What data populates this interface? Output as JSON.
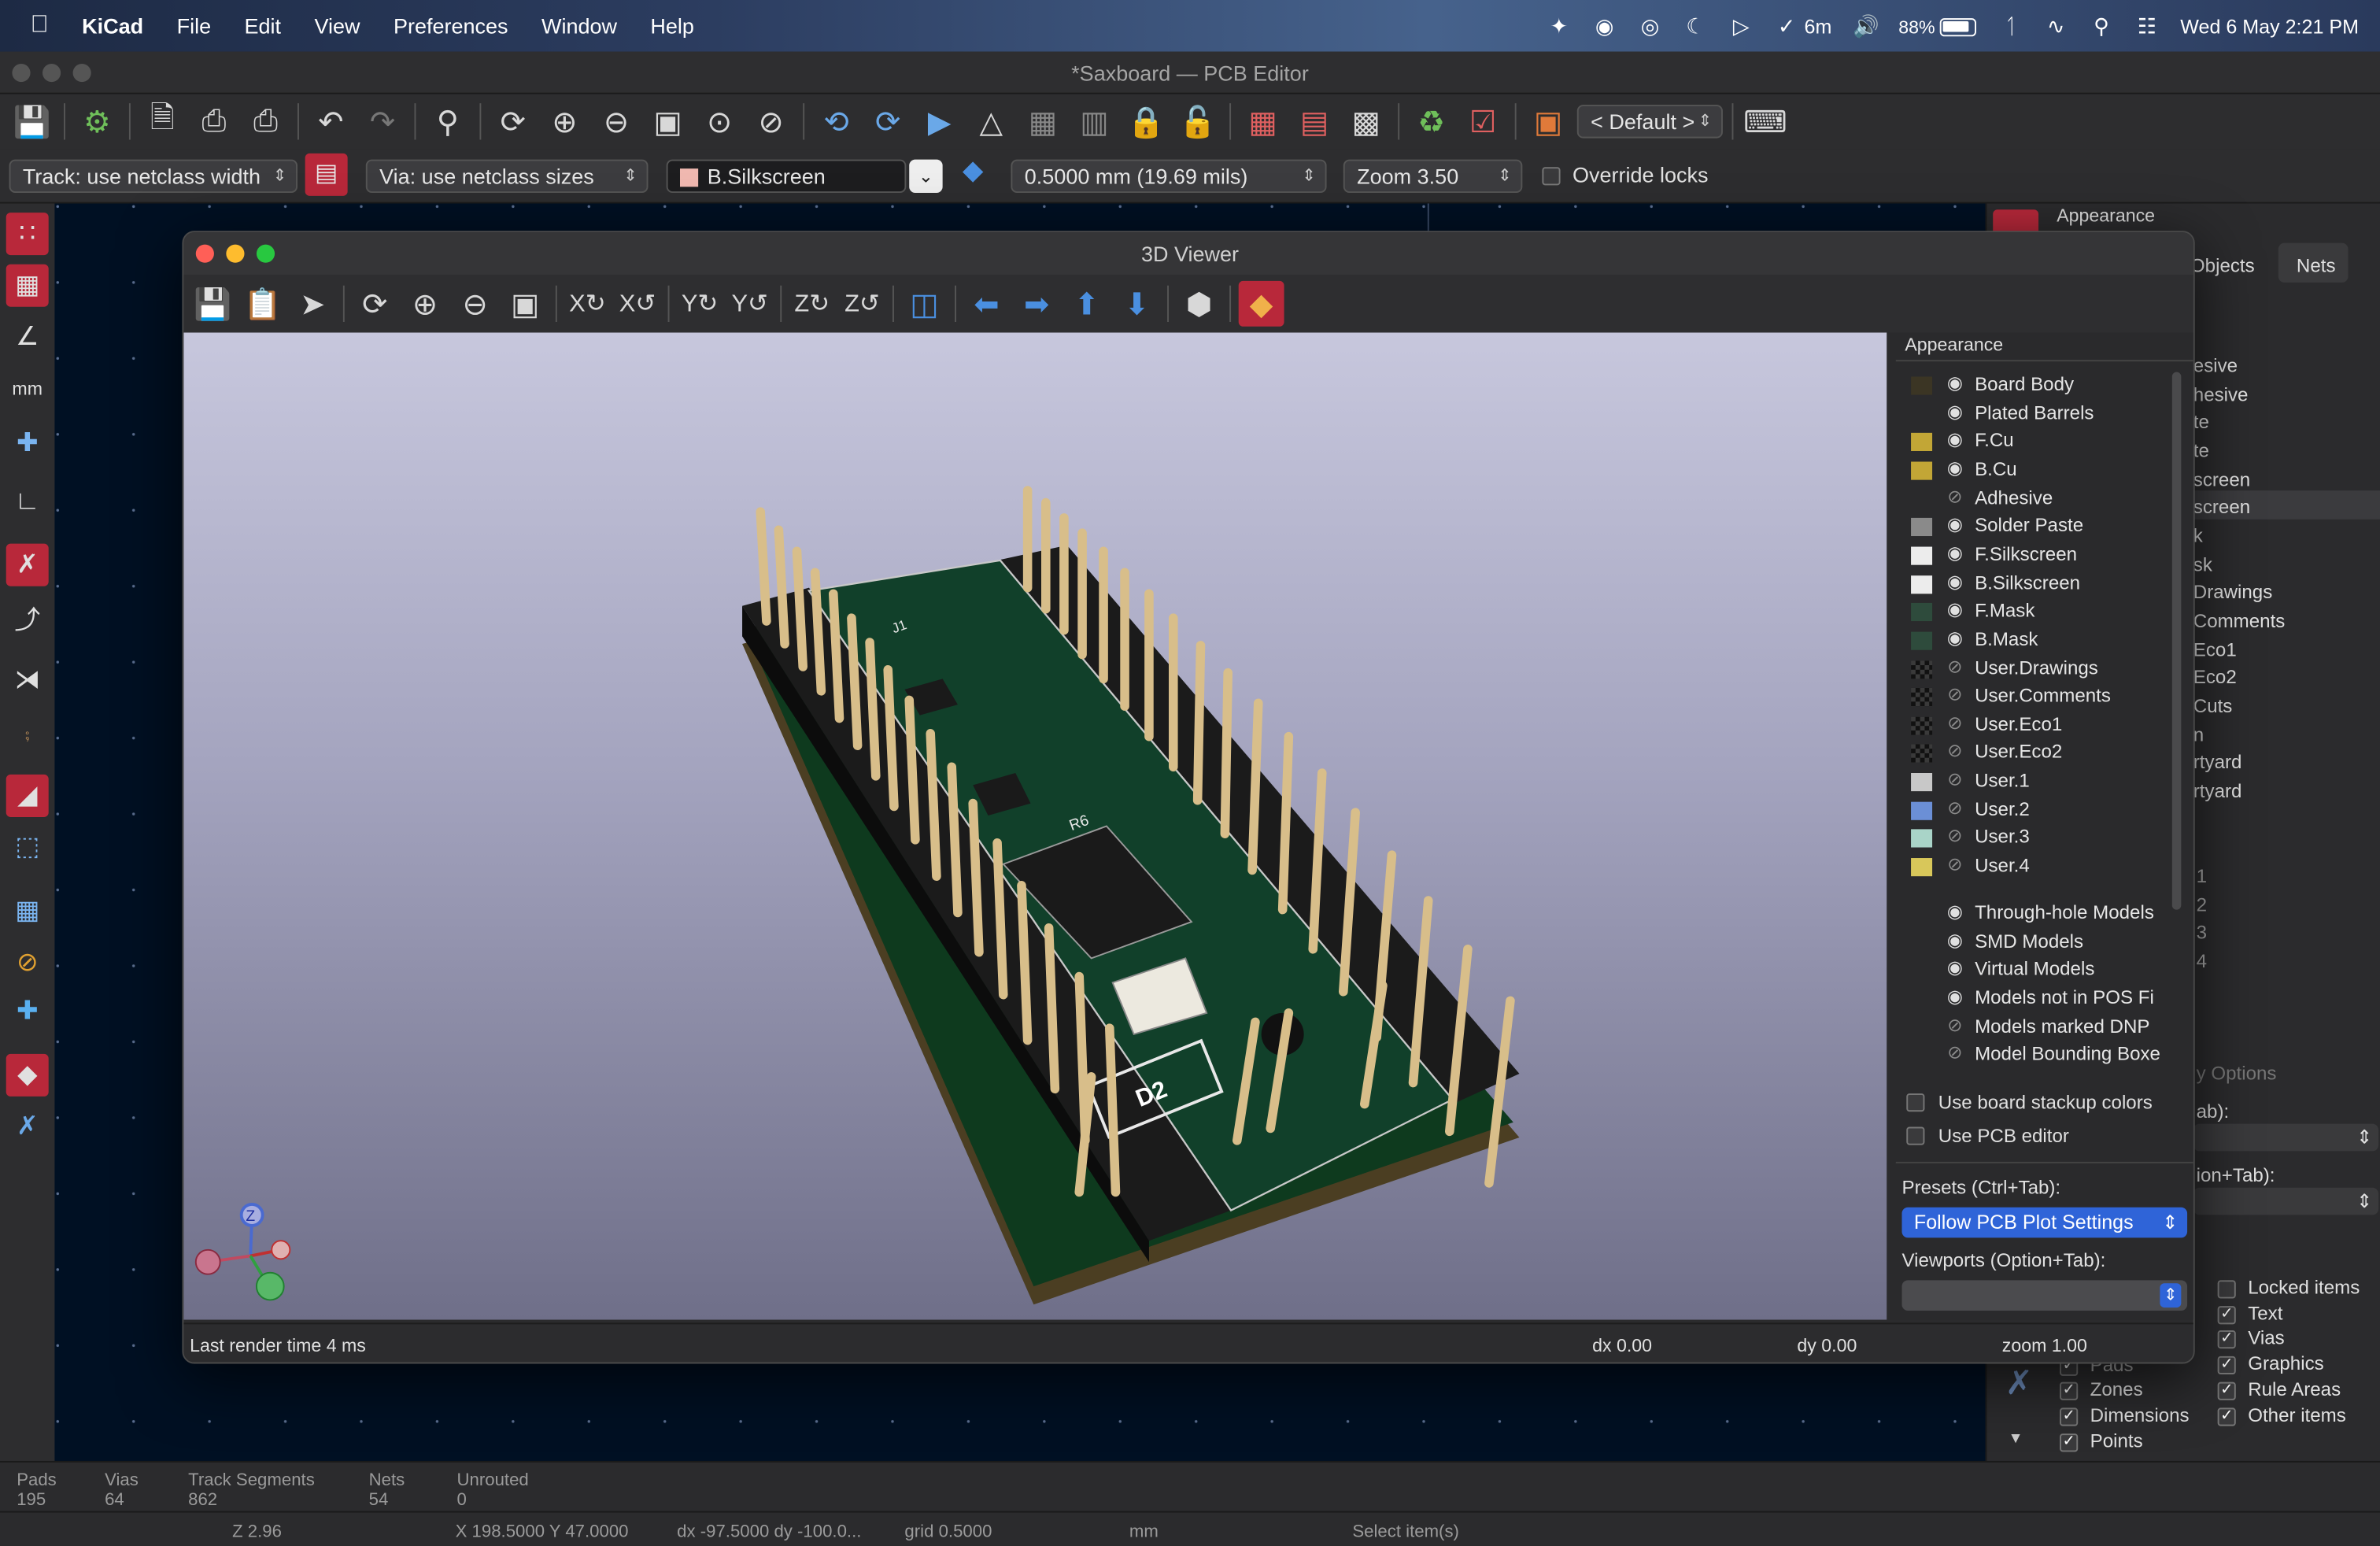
{
  "menubar": {
    "app": "KiCad",
    "menus": [
      "File",
      "Edit",
      "View",
      "Preferences",
      "Window",
      "Help"
    ],
    "timer": "6m",
    "battery": "88%",
    "datetime": "Wed 6 May  2:21 PM"
  },
  "main": {
    "title": "*Saxboard — PCB Editor",
    "preset_select": "< Default >",
    "track_select": "Track: use netclass width",
    "via_select": "Via: use netclass sizes",
    "layer_select": "B.Silkscreen",
    "grid_select": "0.5000 mm (19.69 mils)",
    "zoom_select": "Zoom 3.50",
    "override_locks": "Override locks"
  },
  "rpanel": {
    "title": "Appearance",
    "tab_objects": "Objects",
    "tab_nets": "Nets",
    "layers_partial": [
      "esive",
      "hesive",
      "te",
      "te",
      "screen",
      "screen",
      "k",
      "sk",
      "Drawings",
      "Comments",
      "Eco1",
      "Eco2",
      "Cuts",
      "n",
      "rtyard",
      "rtyard"
    ],
    "nums_partial": [
      "1",
      "2",
      "3",
      "4"
    ],
    "options_partial": "y Options",
    "preset_partial": "ab):",
    "viewport_partial": "ion+Tab):",
    "objects_left": [
      {
        "label": "Pads",
        "checked": true
      },
      {
        "label": "Zones",
        "checked": true
      },
      {
        "label": "Dimensions",
        "checked": true
      },
      {
        "label": "Points",
        "checked": true
      }
    ],
    "objects_right": [
      {
        "label": "Locked items",
        "checked": false
      },
      {
        "label": "Text",
        "checked": true
      },
      {
        "label": "Vias",
        "checked": true
      },
      {
        "label": "Graphics",
        "checked": true
      },
      {
        "label": "Rule Areas",
        "checked": true
      },
      {
        "label": "Other items",
        "checked": true
      }
    ]
  },
  "bottom": {
    "stats": [
      {
        "label": "Pads",
        "value": "195"
      },
      {
        "label": "Vias",
        "value": "64"
      },
      {
        "label": "Track Segments",
        "value": "862"
      },
      {
        "label": "Nets",
        "value": "54"
      },
      {
        "label": "Unrouted",
        "value": "0"
      }
    ],
    "z": "Z 2.96",
    "xy": "X 198.5000  Y 47.0000",
    "dxdy": "dx -97.5000  dy -100.0...",
    "grid": "grid 0.5000",
    "units": "mm",
    "message": "Select item(s)"
  },
  "viewer": {
    "title": "3D Viewer",
    "appearance_title": "Appearance",
    "layers": [
      {
        "name": "Board Body",
        "color": "#3b3524",
        "visible": true
      },
      {
        "name": "Plated Barrels",
        "color": "",
        "visible": true
      },
      {
        "name": "F.Cu",
        "color": "#c2a636",
        "visible": true
      },
      {
        "name": "B.Cu",
        "color": "#c2a636",
        "visible": true
      },
      {
        "name": "Adhesive",
        "color": "",
        "visible": false
      },
      {
        "name": "Solder Paste",
        "color": "#8a8a8a",
        "visible": true
      },
      {
        "name": "F.Silkscreen",
        "color": "#ececec",
        "visible": true
      },
      {
        "name": "B.Silkscreen",
        "color": "#ececec",
        "visible": true
      },
      {
        "name": "F.Mask",
        "color": "#2e4b3c",
        "visible": true
      },
      {
        "name": "B.Mask",
        "color": "#2e4b3c",
        "visible": true
      },
      {
        "name": "User.Drawings",
        "color": "checker",
        "visible": false
      },
      {
        "name": "User.Comments",
        "color": "checker",
        "visible": false
      },
      {
        "name": "User.Eco1",
        "color": "checker",
        "visible": false
      },
      {
        "name": "User.Eco2",
        "color": "checker",
        "visible": false
      },
      {
        "name": "User.1",
        "color": "#c8c8c8",
        "visible": false
      },
      {
        "name": "User.2",
        "color": "#6b8fd6",
        "visible": false
      },
      {
        "name": "User.3",
        "color": "#a9d4c8",
        "visible": false
      },
      {
        "name": "User.4",
        "color": "#d8c75a",
        "visible": false
      }
    ],
    "models": [
      {
        "name": "Through-hole Models",
        "visible": true
      },
      {
        "name": "SMD Models",
        "visible": true
      },
      {
        "name": "Virtual Models",
        "visible": true
      },
      {
        "name": "Models not in POS Fi",
        "visible": true
      },
      {
        "name": "Models marked DNP",
        "visible": false
      },
      {
        "name": "Model Bounding Boxe",
        "visible": false
      }
    ],
    "use_stackup": "Use board stackup colors",
    "use_pcb": "Use PCB editor",
    "presets_label": "Presets (Ctrl+Tab):",
    "presets_value": "Follow PCB Plot Settings",
    "viewports_label": "Viewports (Option+Tab):",
    "viewports_value": "",
    "render_time": "Last render time 4 ms",
    "dx": "dx 0.00",
    "dy": "dy 0.00",
    "zoom": "zoom 1.00",
    "board_labels": {
      "j1": "J1",
      "d2": "D2",
      "r6": "R6"
    },
    "axis_labels": {
      "z": "Z"
    }
  }
}
